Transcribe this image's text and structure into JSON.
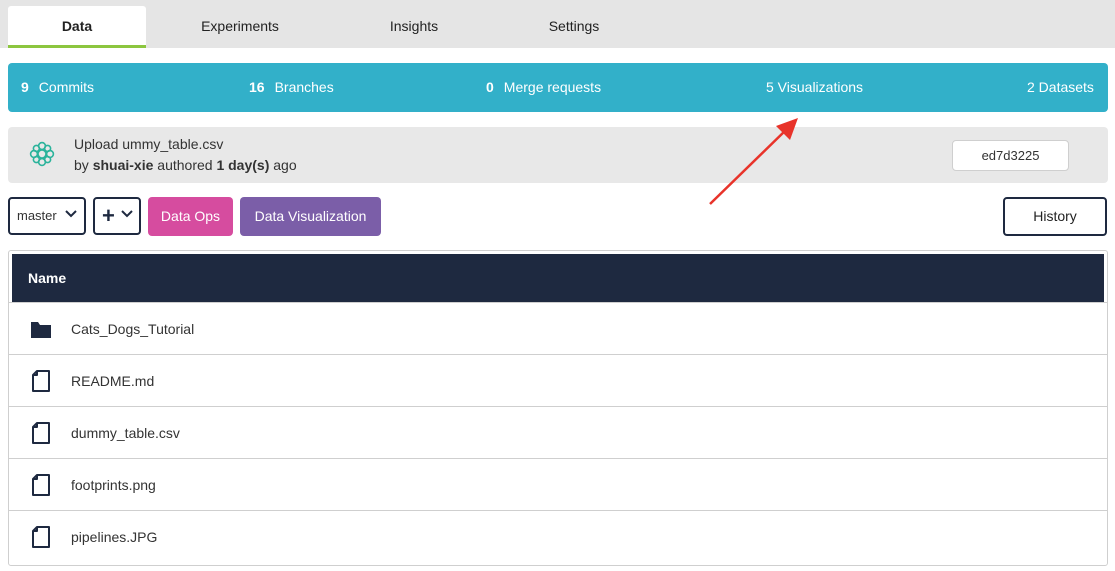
{
  "tabs": [
    {
      "label": "Data",
      "active": true
    },
    {
      "label": "Experiments",
      "active": false
    },
    {
      "label": "Insights",
      "active": false
    },
    {
      "label": "Settings",
      "active": false
    }
  ],
  "stats": {
    "commits": {
      "count": "9",
      "label": "Commits"
    },
    "branches": {
      "count": "16",
      "label": "Branches"
    },
    "merge_requests": {
      "count": "0",
      "label": "Merge requests"
    },
    "visualizations": {
      "label": "5 Visualizations"
    },
    "datasets": {
      "label": "2 Datasets"
    }
  },
  "commit": {
    "message": "Upload ummy_table.csv",
    "by_prefix": "by",
    "author": "shuai-xie",
    "authored_word": "authored",
    "time": "1 day(s)",
    "ago": "ago",
    "sha": "ed7d3225"
  },
  "toolbar": {
    "branch": "master",
    "add_symbol": "+",
    "data_ops": "Data Ops",
    "data_visualization": "Data Visualization",
    "history": "History"
  },
  "files": {
    "header": "Name",
    "items": [
      {
        "name": "Cats_Dogs_Tutorial",
        "type": "folder"
      },
      {
        "name": "README.md",
        "type": "file"
      },
      {
        "name": "dummy_table.csv",
        "type": "file"
      },
      {
        "name": "footprints.png",
        "type": "file"
      },
      {
        "name": "pipelines.JPG",
        "type": "file"
      }
    ]
  },
  "colors": {
    "stats_bar": "#32b0c9",
    "tab_active_underline": "#8cc63f",
    "data_ops": "#d64c9f",
    "data_visualization": "#7b5ea8",
    "header_dark": "#1e2940",
    "annotation_arrow": "#e8332a"
  },
  "icons": {
    "avatar": "flower-avatar-icon",
    "folder": "folder-icon",
    "file": "file-icon",
    "chevron": "chevron-down-icon"
  }
}
